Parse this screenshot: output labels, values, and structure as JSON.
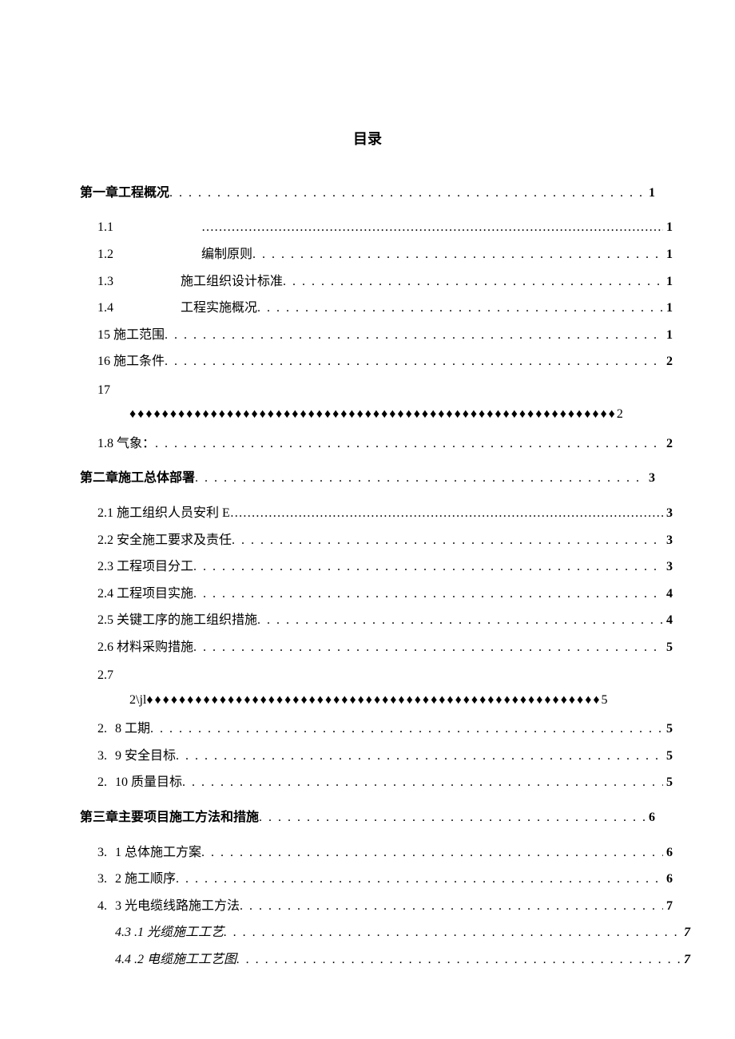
{
  "title": "目录",
  "entries": [
    {
      "type": "line",
      "level": 0,
      "num": "",
      "label": "第一章工程概况",
      "page": "1",
      "dotStyle": "dots",
      "bold": true
    },
    {
      "type": "line",
      "level": 1,
      "num": "1.1",
      "gap": 110,
      "label": "",
      "page": "1",
      "dotStyle": "ellipsis"
    },
    {
      "type": "line",
      "level": 1,
      "num": "1.2",
      "gap": 110,
      "label": "编制原则",
      "page": "1",
      "dotStyle": "dots"
    },
    {
      "type": "line",
      "level": 1,
      "num": "1.3",
      "gap": 84,
      "label": "施工组织设计标准",
      "page": "1",
      "dotStyle": "dots"
    },
    {
      "type": "line",
      "level": 1,
      "num": "1.4",
      "gap": 84,
      "label": "工程实施概况",
      "page": "1",
      "dotStyle": "dots"
    },
    {
      "type": "line",
      "level": 1,
      "num": "",
      "label": "15 施工范围",
      "page": "1",
      "dotStyle": "dots"
    },
    {
      "type": "line",
      "level": 1,
      "num": "",
      "label": "16 施工条件",
      "page": "2",
      "dotStyle": "dots"
    },
    {
      "type": "diamonds",
      "num": "17",
      "prefix": "",
      "trail": "2",
      "diamondsLead": 0,
      "diamondsMain": 60
    },
    {
      "type": "line",
      "level": 1,
      "num": "",
      "label": "1.8 气象：",
      "page": "2",
      "dotStyle": "dots"
    },
    {
      "type": "line",
      "level": 0,
      "num": "",
      "label": "第二章施工总体部署",
      "page": "3",
      "dotStyle": "dots",
      "bold": true
    },
    {
      "type": "line",
      "level": 1,
      "num": "",
      "label": "2.1 施工组织人员安利 E",
      "page": "3",
      "dotStyle": "ellipsis"
    },
    {
      "type": "line",
      "level": 1,
      "num": "",
      "label": "2.2 安全施工要求及责任",
      "page": "3",
      "dotStyle": "dots"
    },
    {
      "type": "line",
      "level": 1,
      "num": "",
      "label": "2.3 工程项目分工",
      "page": "3",
      "dotStyle": "dots"
    },
    {
      "type": "line",
      "level": 1,
      "num": "",
      "label": "2.4 工程项目实施",
      "page": "4",
      "dotStyle": "dots"
    },
    {
      "type": "line",
      "level": 1,
      "num": "",
      "label": "2.5 关键工序的施工组织措施",
      "page": "4",
      "dotStyle": "dots"
    },
    {
      "type": "line",
      "level": 1,
      "num": "",
      "label": "2.6 材料采购措施",
      "page": "5",
      "dotStyle": "dots"
    },
    {
      "type": "diamonds",
      "num": "2.7",
      "prefix": "2\\jl",
      "trail": "5",
      "diamondsLead": 0,
      "diamondsMain": 56
    },
    {
      "type": "line",
      "level": 1,
      "num": "2.",
      "gap": 10,
      "label": "8 工期",
      "page": "5",
      "dotStyle": "dots"
    },
    {
      "type": "line",
      "level": 1,
      "num": "3.",
      "gap": 10,
      "label": "9 安全目标",
      "page": "5",
      "dotStyle": "dots"
    },
    {
      "type": "line",
      "level": 1,
      "num": "2.",
      "gap": 10,
      "label": "10 质量目标",
      "page": "5",
      "dotStyle": "dots"
    },
    {
      "type": "line",
      "level": 0,
      "num": "",
      "label": "第三章主要项目施工方法和措施",
      "page": "6",
      "dotStyle": "dots",
      "bold": true
    },
    {
      "type": "line",
      "level": 1,
      "num": "3.",
      "gap": 10,
      "label": "1 总体施工方案",
      "page": "6",
      "dotStyle": "dots"
    },
    {
      "type": "line",
      "level": 1,
      "num": "3.",
      "gap": 10,
      "label": "2 施工顺序",
      "page": "6",
      "dotStyle": "dots"
    },
    {
      "type": "line",
      "level": 1,
      "num": "4.",
      "gap": 10,
      "label": "3 光电缆线路施工方法",
      "page": "7",
      "dotStyle": "dots"
    },
    {
      "type": "line",
      "level": 2,
      "num": "",
      "label": "4.3 .1 光缆施工工艺",
      "page": "7",
      "dotStyle": "dots"
    },
    {
      "type": "line",
      "level": 2,
      "num": "",
      "label": "4.4 .2 电缆施工工艺图",
      "page": "7",
      "dotStyle": "dots"
    }
  ]
}
